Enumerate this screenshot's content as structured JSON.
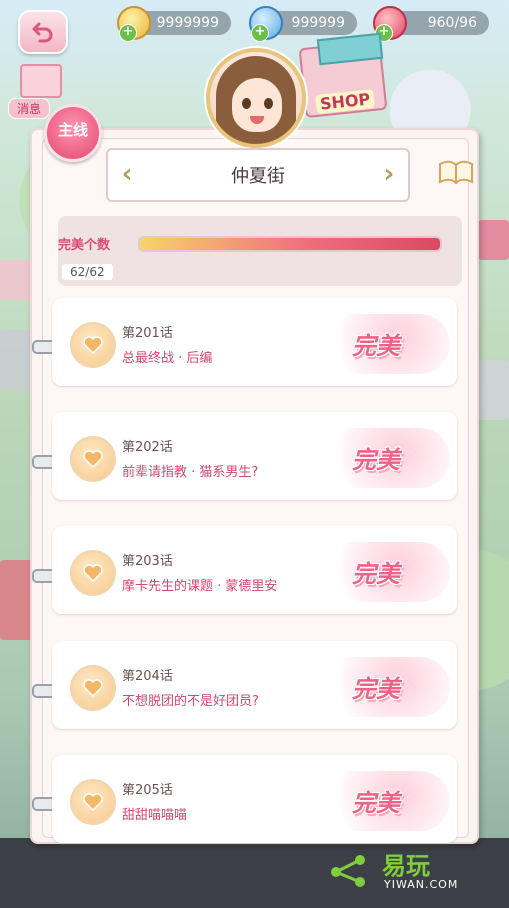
{
  "resources": {
    "gold": "9999999",
    "gem": "999999",
    "stamina": "960/96"
  },
  "side": {
    "message_label": "消息",
    "shop_sign": "SHOP"
  },
  "tag_main": "主线",
  "header": {
    "title": "仲夏街"
  },
  "progress": {
    "label": "完美个数",
    "count": "62/62",
    "fraction": 1.0
  },
  "chapters": [
    {
      "num": "第201话",
      "title": "总最终战 · 后编",
      "grade": "完美"
    },
    {
      "num": "第202话",
      "title": "前辈请指教 · 猫系男生?",
      "grade": "完美"
    },
    {
      "num": "第203话",
      "title": "摩卡先生的课题 · 蒙德里安",
      "grade": "完美"
    },
    {
      "num": "第204话",
      "title": "不想脱团的不是好团员?",
      "grade": "完美"
    },
    {
      "num": "第205话",
      "title": "甜甜喵喵喵",
      "grade": "完美"
    }
  ],
  "watermark": {
    "cn": "易玩",
    "en": "YIWAN.COM"
  },
  "colors": {
    "accent": "#d24870",
    "perfect": "#f06186"
  }
}
